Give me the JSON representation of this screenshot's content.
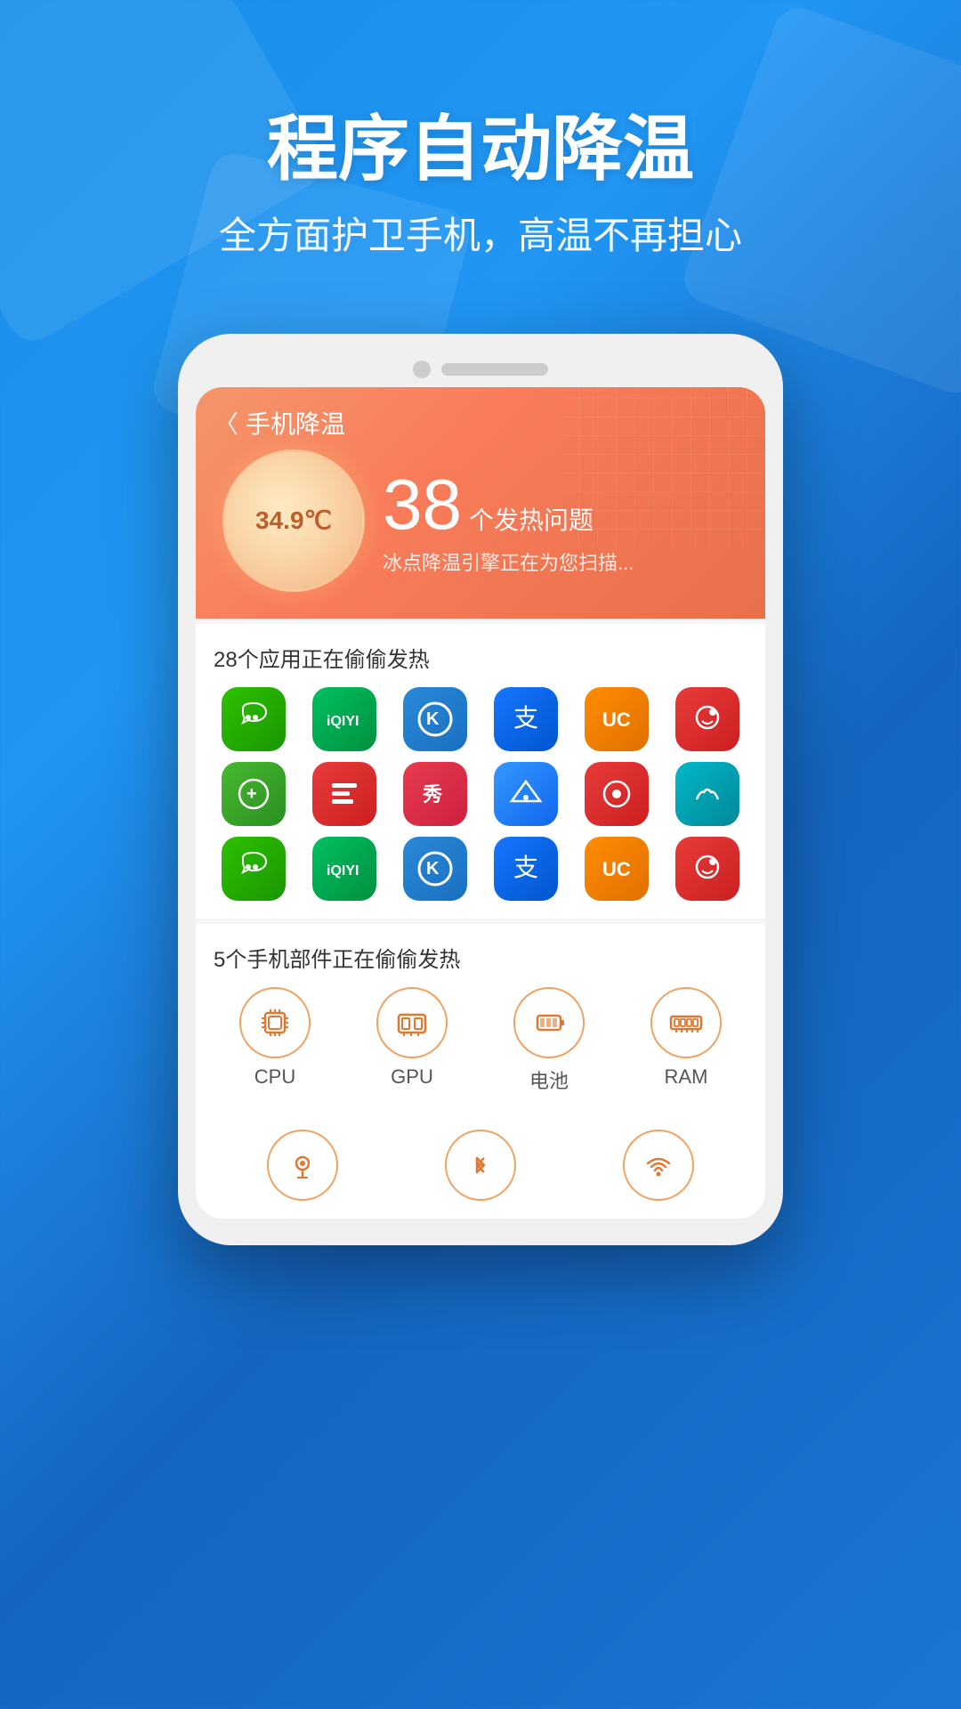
{
  "header": {
    "title": "程序自动降温",
    "subtitle": "全方面护卫手机，高温不再担心"
  },
  "phone": {
    "nav_back": "〈",
    "nav_title": "手机降温",
    "temperature": "34.9℃",
    "heat_count": "38",
    "heat_label": "个发热问题",
    "heat_desc": "冰点降温引擎正在为您扫描...",
    "apps_title": "28个应用正在偷偷发热",
    "hardware_title": "5个手机部件正在偷偷发热",
    "apps_row1": [
      {
        "name": "微信",
        "class": "wechat"
      },
      {
        "name": "爱奇艺",
        "class": "iqiyi"
      },
      {
        "name": "酷狗",
        "class": "kugou"
      },
      {
        "name": "支付宝",
        "class": "alipay"
      },
      {
        "name": "UC",
        "class": "uc"
      },
      {
        "name": "微博",
        "class": "weibo"
      }
    ],
    "apps_row2": [
      {
        "name": "游戏",
        "class": "game"
      },
      {
        "name": "头条",
        "class": "toutiao"
      },
      {
        "name": "美秀",
        "class": "xiuxiu"
      },
      {
        "name": "高德",
        "class": "gaode"
      },
      {
        "name": "网易",
        "class": "netease"
      },
      {
        "name": "骆驼",
        "class": "camel"
      }
    ],
    "apps_row3": [
      {
        "name": "微信",
        "class": "wechat"
      },
      {
        "name": "爱奇艺",
        "class": "iqiyi"
      },
      {
        "name": "酷狗",
        "class": "kugou"
      },
      {
        "name": "支付宝",
        "class": "alipay"
      },
      {
        "name": "UC",
        "class": "uc"
      },
      {
        "name": "微博",
        "class": "weibo"
      }
    ],
    "hardware_items": [
      {
        "label": "CPU",
        "icon": "cpu"
      },
      {
        "label": "GPU",
        "icon": "gpu"
      },
      {
        "label": "电池",
        "icon": "battery"
      },
      {
        "label": "RAM",
        "icon": "ram"
      }
    ],
    "bottom_items": [
      {
        "label": "",
        "icon": "location"
      },
      {
        "label": "",
        "icon": "bluetooth"
      },
      {
        "label": "",
        "icon": "wifi"
      }
    ]
  }
}
